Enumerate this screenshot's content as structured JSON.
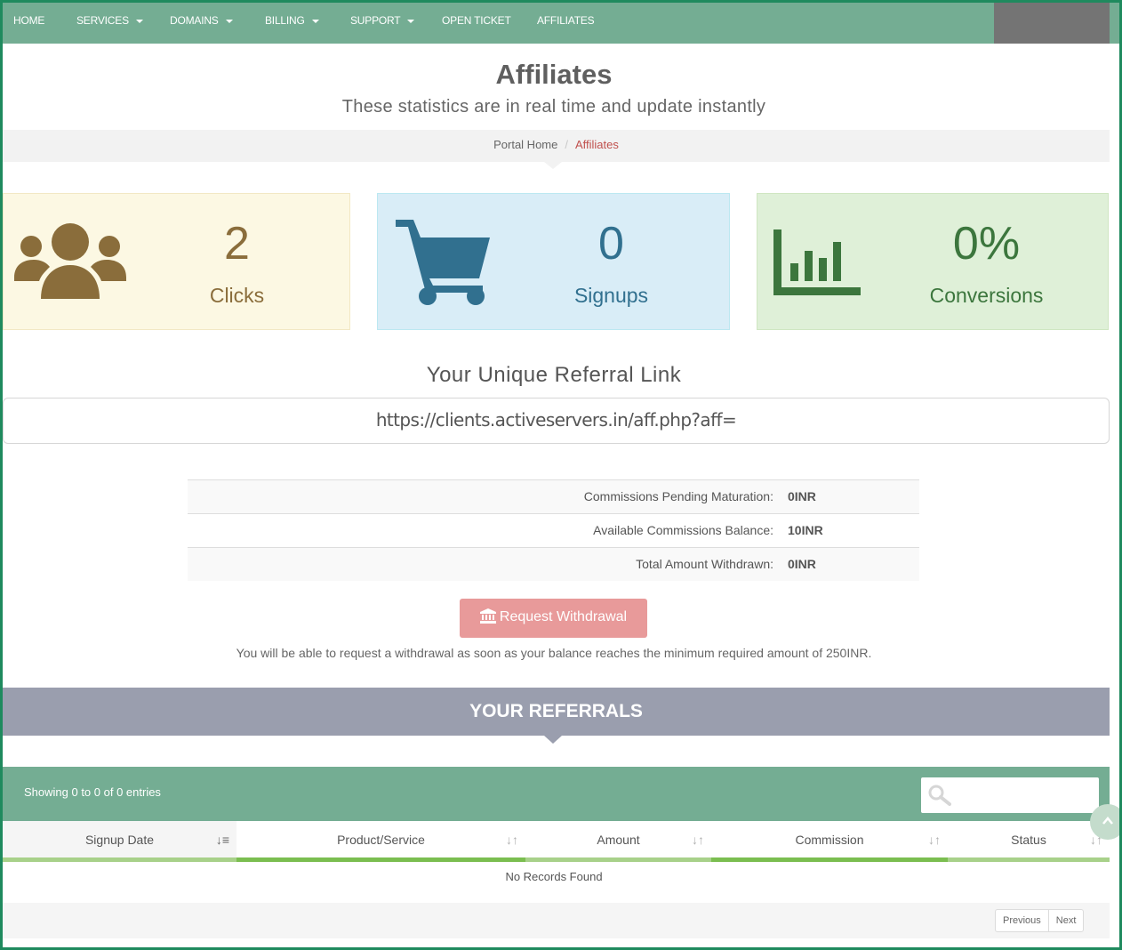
{
  "nav": {
    "items": [
      {
        "label": "HOME",
        "dropdown": false
      },
      {
        "label": "SERVICES",
        "dropdown": true
      },
      {
        "label": "DOMAINS",
        "dropdown": true
      },
      {
        "label": "BILLING",
        "dropdown": true
      },
      {
        "label": "SUPPORT",
        "dropdown": true
      },
      {
        "label": "OPEN TICKET",
        "dropdown": false
      },
      {
        "label": "AFFILIATES",
        "dropdown": false
      }
    ],
    "bg_color": "#74ad93"
  },
  "header": {
    "title": "Affiliates",
    "subtitle": "These statistics are in real time and update instantly"
  },
  "breadcrumb": {
    "home": "Portal Home",
    "separator": "/",
    "active": "Affiliates"
  },
  "stats": {
    "clicks": {
      "value": "2",
      "label": "Clicks",
      "icon": "users-icon",
      "color": "#8a6d3b"
    },
    "signups": {
      "value": "0",
      "label": "Signups",
      "icon": "cart-icon",
      "color": "#31708f"
    },
    "conversions": {
      "value": "0%",
      "label": "Conversions",
      "icon": "bar-chart-icon",
      "color": "#3c763d"
    }
  },
  "referral": {
    "heading": "Your Unique Referral Link",
    "link": "https://clients.activeservers.in/aff.php?aff="
  },
  "commissions": [
    {
      "label": "Commissions Pending Maturation:",
      "value": "0INR"
    },
    {
      "label": "Available Commissions Balance:",
      "value": "10INR"
    },
    {
      "label": "Total Amount Withdrawn:",
      "value": "0INR"
    }
  ],
  "withdraw": {
    "button_label": "Request Withdrawal",
    "note": "You will be able to request a withdrawal as soon as your balance reaches the minimum required amount of 250INR.",
    "button_color": "#e89a9a"
  },
  "referrals": {
    "heading": "YOUR REFERRALS",
    "showing": "Showing 0 to 0 of 0 entries",
    "columns": [
      "Signup Date",
      "Product/Service",
      "Amount",
      "Commission",
      "Status"
    ],
    "empty": "No Records Found",
    "pager": {
      "previous": "Previous",
      "next": "Next"
    }
  }
}
